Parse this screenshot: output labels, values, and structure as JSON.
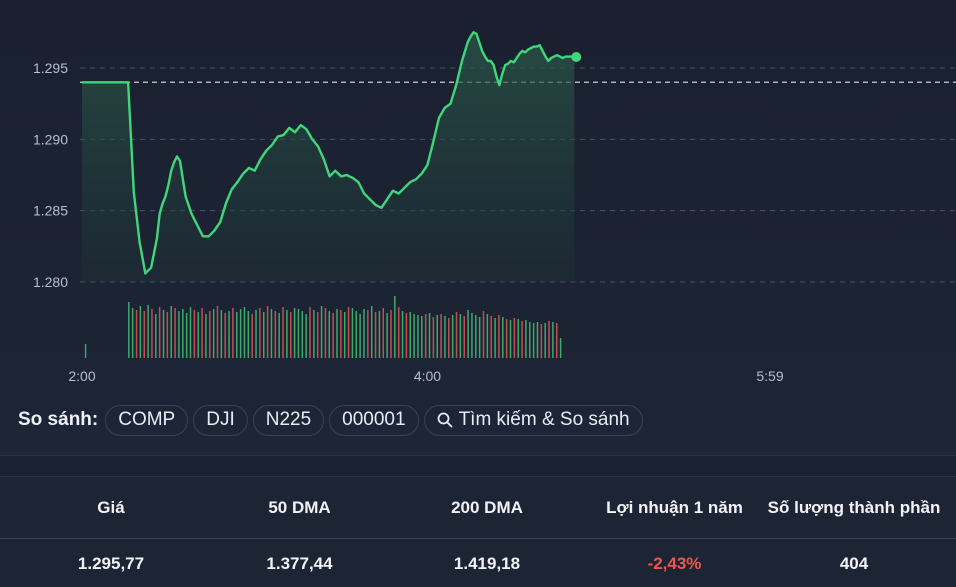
{
  "chart_data": {
    "type": "line",
    "x_ticks": [
      "2:00",
      "4:00",
      "5:59"
    ],
    "y_ticks": [
      "1.280",
      "1.285",
      "1.290",
      "1.295"
    ],
    "y_tick_values": [
      1.28,
      1.285,
      1.29,
      1.295
    ],
    "reference_line": 1.294,
    "last_value": 1.29577,
    "x_range_minutes": [
      0,
      239
    ],
    "ylim": [
      1.277,
      1.2995
    ],
    "series": [
      {
        "x": [
          0,
          11,
          16,
          18,
          20,
          22,
          24,
          26,
          27,
          28,
          29,
          30,
          31,
          32,
          33,
          34,
          36,
          38,
          40,
          42,
          44,
          46,
          48,
          50,
          52,
          54,
          56,
          58,
          60,
          62,
          64,
          66,
          68,
          70,
          72,
          74,
          76,
          78,
          80,
          82,
          84,
          86,
          88,
          90,
          92,
          94,
          96,
          98,
          100,
          102,
          104,
          106,
          108,
          110,
          112,
          114,
          116,
          118,
          120,
          122,
          124,
          126,
          128,
          130,
          132,
          134,
          135,
          136,
          137,
          138,
          139,
          140,
          141,
          142,
          143,
          144,
          145,
          146,
          147,
          148,
          149,
          150,
          151,
          152,
          153,
          154,
          155,
          156,
          157,
          158,
          159,
          160,
          161,
          162,
          163,
          164,
          165,
          166,
          167,
          168,
          169,
          170,
          171
        ],
        "values": [
          1.294,
          1.294,
          1.294,
          1.2863,
          1.2828,
          1.2806,
          1.281,
          1.283,
          1.2848,
          1.2855,
          1.286,
          1.2868,
          1.2878,
          1.2884,
          1.2888,
          1.2885,
          1.286,
          1.2848,
          1.284,
          1.2832,
          1.2832,
          1.2836,
          1.2842,
          1.2855,
          1.2865,
          1.287,
          1.2876,
          1.288,
          1.2878,
          1.2886,
          1.2892,
          1.2896,
          1.2902,
          1.2903,
          1.2908,
          1.2905,
          1.291,
          1.2907,
          1.29,
          1.2895,
          1.2886,
          1.2874,
          1.2878,
          1.2874,
          1.2875,
          1.2873,
          1.287,
          1.2862,
          1.2858,
          1.2854,
          1.2852,
          1.2858,
          1.2864,
          1.2862,
          1.2866,
          1.287,
          1.2872,
          1.2876,
          1.2882,
          1.2898,
          1.2915,
          1.2922,
          1.2925,
          1.2938,
          1.2955,
          1.2968,
          1.2972,
          1.2975,
          1.2974,
          1.2968,
          1.2962,
          1.2958,
          1.2955,
          1.2955,
          1.2952,
          1.2944,
          1.2938,
          1.2946,
          1.2952,
          1.2953,
          1.2955,
          1.2954,
          1.2957,
          1.296,
          1.2962,
          1.2961,
          1.2963,
          1.2964,
          1.2965,
          1.2965,
          1.2966,
          1.2962,
          1.2958,
          1.2955,
          1.2957,
          1.2958,
          1.2959,
          1.2958,
          1.2957,
          1.2958,
          1.2958,
          1.2958,
          1.29577
        ]
      }
    ],
    "volume": {
      "x_start": 16,
      "x_end": 166,
      "bars": [
        56,
        50,
        48,
        52,
        47,
        53,
        49,
        44,
        51,
        48,
        46,
        52,
        50,
        47,
        49,
        45,
        51,
        48,
        46,
        50,
        44,
        47,
        49,
        52,
        48,
        45,
        47,
        50,
        46,
        49,
        51,
        47,
        44,
        48,
        50,
        46,
        52,
        49,
        47,
        45,
        51,
        48,
        46,
        50,
        49,
        47,
        44,
        51,
        48,
        46,
        52,
        50,
        47,
        45,
        49,
        48,
        46,
        51,
        50,
        47,
        44,
        49,
        48,
        52,
        46,
        47,
        50,
        45,
        48,
        62,
        51,
        47,
        45,
        46,
        44,
        43,
        42,
        44,
        45,
        41,
        43,
        44,
        42,
        40,
        43,
        46,
        44,
        42,
        48,
        45,
        43,
        41,
        47,
        44,
        42,
        40,
        43,
        41,
        39,
        38,
        40,
        39,
        37,
        38,
        36,
        35,
        36,
        34,
        35,
        37,
        36,
        35,
        20
      ],
      "first_bar_x": 1,
      "first_bar_height": 14
    },
    "colors": {
      "line": "#3fd77a",
      "fill_top": "#2b5a4a",
      "volume_up": "#3fa86a",
      "volume_down": "#c0514f",
      "grid": "#4a5264",
      "reference": "#c9ced8"
    }
  },
  "compare": {
    "label": "So sánh:",
    "chips": [
      "COMP",
      "DJI",
      "N225",
      "000001"
    ],
    "search_label": "Tìm kiếm & So sánh"
  },
  "stats": {
    "headers": [
      "Giá",
      "50 DMA",
      "200 DMA",
      "Lợi nhuận 1 năm",
      "Số lượng thành phần"
    ],
    "values": [
      "1.295,77",
      "1.377,44",
      "1.419,18",
      "-2,43%",
      "404"
    ]
  }
}
